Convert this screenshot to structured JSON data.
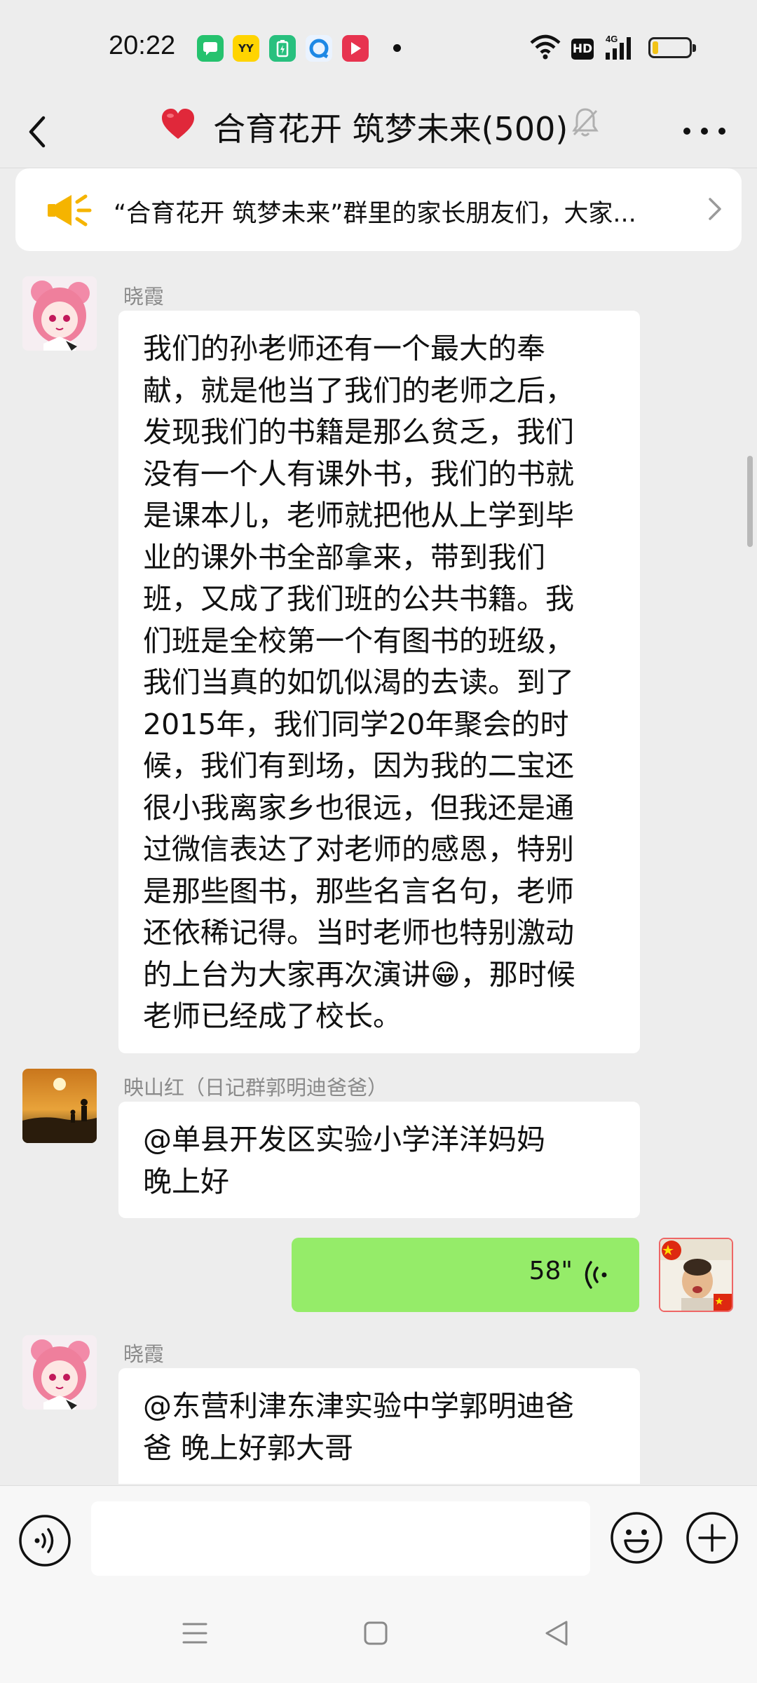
{
  "status_bar": {
    "time": "20:22",
    "app_icons": [
      "messages-icon",
      "yy-icon",
      "battery-app-icon",
      "browser-icon",
      "video-icon"
    ],
    "hd_label": "HD",
    "network_label": "4G",
    "battery_level": 0.15
  },
  "title_bar": {
    "title": "合育花开 筑梦未来(500)",
    "title_emoji": "heart",
    "muted": true
  },
  "notice": {
    "text": "“合育花开 筑梦未来”群里的家长朋友们，大家..."
  },
  "messages": [
    {
      "sender": "晓霞",
      "lines": [
        "我们的孙老师还有一个最大的奉",
        "献，就是他当了我们的老师之后，",
        "发现我们的书籍是那么贫乏，我们",
        "没有一个人有课外书，我们的书就",
        "是课本儿，老师就把他从上学到毕",
        "业的课外书全部拿来，带到我们",
        "班，又成了我们班的公共书籍。我",
        "们班是全校第一个有图书的班级，",
        "我们当真的如饥似渴的去读。到了",
        "2015年，我们同学20年聚会的时",
        "候，我们有到场，因为我的二宝还",
        "很小我离家乡也很远，但我还是通",
        "过微信表达了对老师的感恩，特别",
        "是那些图书，那些名言名句，老师",
        "还依稀记得。当时老师也特别激动",
        "的上台为大家再次演讲😁，那时候",
        "老师已经成了校长。"
      ]
    },
    {
      "sender": "映山红（日记群郭明迪爸爸）",
      "lines": [
        "@单县开发区实验小学洋洋妈妈",
        "晚上好"
      ]
    },
    {
      "sender": "",
      "voice_duration": "58\"",
      "outgoing": true
    },
    {
      "sender": "晓霞",
      "lines": [
        "@东营利津东津实验中学郭明迪爸",
        "爸  晚上好郭大哥"
      ]
    }
  ],
  "input": {
    "value": "",
    "placeholder": ""
  },
  "colors": {
    "background": "#ededed",
    "bubble_incoming": "#ffffff",
    "bubble_outgoing": "#95ec69",
    "sender_name": "#8a8a8a",
    "notice_icon": "#f5b400"
  }
}
